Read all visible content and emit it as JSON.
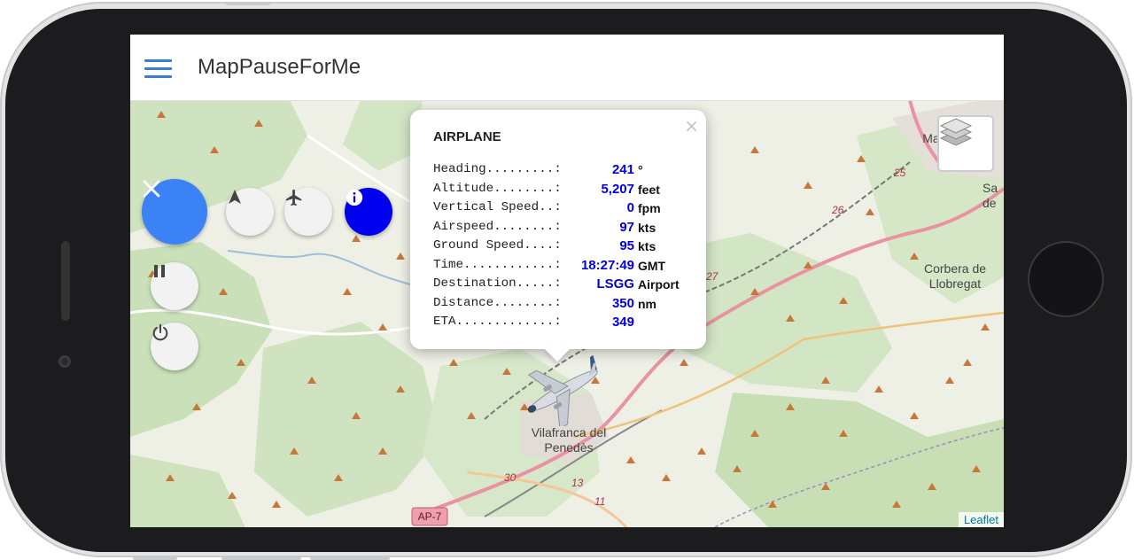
{
  "app": {
    "title": "MapPauseForMe"
  },
  "controls": {
    "close_icon": "close-icon",
    "navigate_icon": "navigation-arrow-icon",
    "airplane_icon": "airplane-icon",
    "info_icon": "info-icon",
    "pause_icon": "pause-icon",
    "power_icon": "power-icon",
    "layers_icon": "layers-icon",
    "info_color": "#0000ee",
    "accent_color": "#3b82f6"
  },
  "popup": {
    "title": "AIRPLANE",
    "close_label": "×",
    "rows": [
      {
        "label": "Heading.........:",
        "value": "241",
        "unit": "°"
      },
      {
        "label": "Altitude........:",
        "value": "5,207",
        "unit": "feet"
      },
      {
        "label": "Vertical Speed..:",
        "value": "0",
        "unit": "fpm"
      },
      {
        "label": "Airspeed........:",
        "value": "97",
        "unit": "kts"
      },
      {
        "label": "Ground Speed....:",
        "value": "95",
        "unit": "kts"
      },
      {
        "label": "Time............:",
        "value": "18:27:49",
        "unit": "GMT"
      },
      {
        "label": "Destination.....:",
        "value": "LSGG",
        "unit": "Airport"
      },
      {
        "label": "Distance........:",
        "value": "350",
        "unit": "nm"
      },
      {
        "label": "ETA.............:",
        "value": "349",
        "unit": ""
      }
    ]
  },
  "map": {
    "labels": {
      "town1": "Vilafranca del",
      "town1b": "Penedès",
      "town2": "Corbera de",
      "town2b": "Llobregat",
      "town3": "Ma",
      "town4": "Sa",
      "town4b": "de",
      "highway": "AP-7"
    },
    "road_numbers": [
      "25",
      "26",
      "27",
      "30",
      "13",
      "11"
    ],
    "attribution": "Leaflet"
  }
}
